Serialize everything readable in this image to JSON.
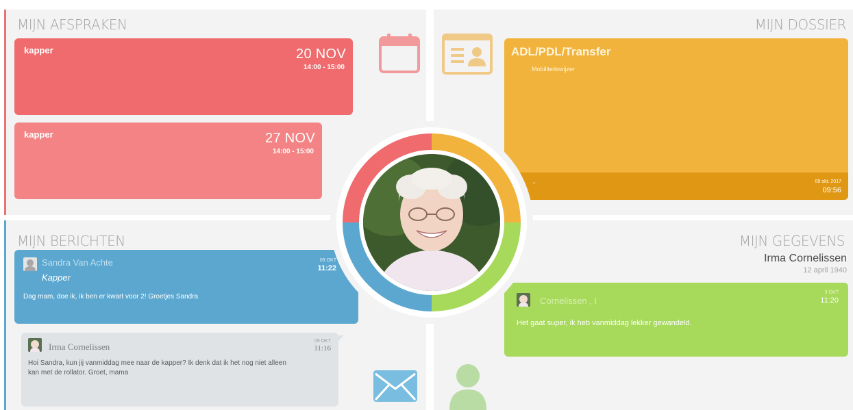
{
  "afspraken": {
    "title": "MIJN AFSPRAKEN",
    "items": [
      {
        "name": "kapper",
        "date": "20 NOV",
        "time": "14:00 - 15:00"
      },
      {
        "name": "kapper",
        "date": "27 NOV",
        "time": "14:00 - 15:00"
      }
    ],
    "icon": "calendar-icon"
  },
  "dossier": {
    "title": "MIJN DOSSIER",
    "card": {
      "title": "ADL/PDL/Transfer",
      "subtitle": "Mobiliteitswijzer",
      "footer_left": "-",
      "footer_date": "09 okt. 2017",
      "footer_time": "09:56"
    },
    "icon": "id-card-icon"
  },
  "berichten": {
    "title": "MIJN BERICHTEN",
    "messages": [
      {
        "sender": "Sandra Van Achte",
        "subject": "Kapper",
        "date": "09 OKT",
        "time": "11:22",
        "body": "Dag mam, doe ik, ik ben er kwart voor 2! Groetjes Sandra"
      },
      {
        "sender": "Irma Cornelissen",
        "date": "09 OKT",
        "time": "11:16",
        "body_line1": "Hoi Sandra, kun jij vanmiddag mee naar de kapper? Ik denk dat ik het nog niet alleen",
        "body_line2": "kan met de rollator. Groet, mama"
      }
    ],
    "icon": "envelope-icon"
  },
  "gegevens": {
    "title": "MIJN GEGEVENS",
    "name": "Irma Cornelissen",
    "birthdate": "12 april 1940",
    "message": {
      "sender": "Cornelissen , I",
      "date": "9 OKT",
      "time": "11:20",
      "body": "Het gaat super, ik heb vanmiddag lekker gewandeld."
    },
    "icon": "person-icon"
  },
  "colors": {
    "red": "#ef6b6d",
    "red_light": "#f38384",
    "orange": "#f1b33c",
    "orange_dark": "#e09814",
    "blue": "#5ba7cf",
    "green": "#a7d95a",
    "gray_card": "#e0e3e6"
  }
}
